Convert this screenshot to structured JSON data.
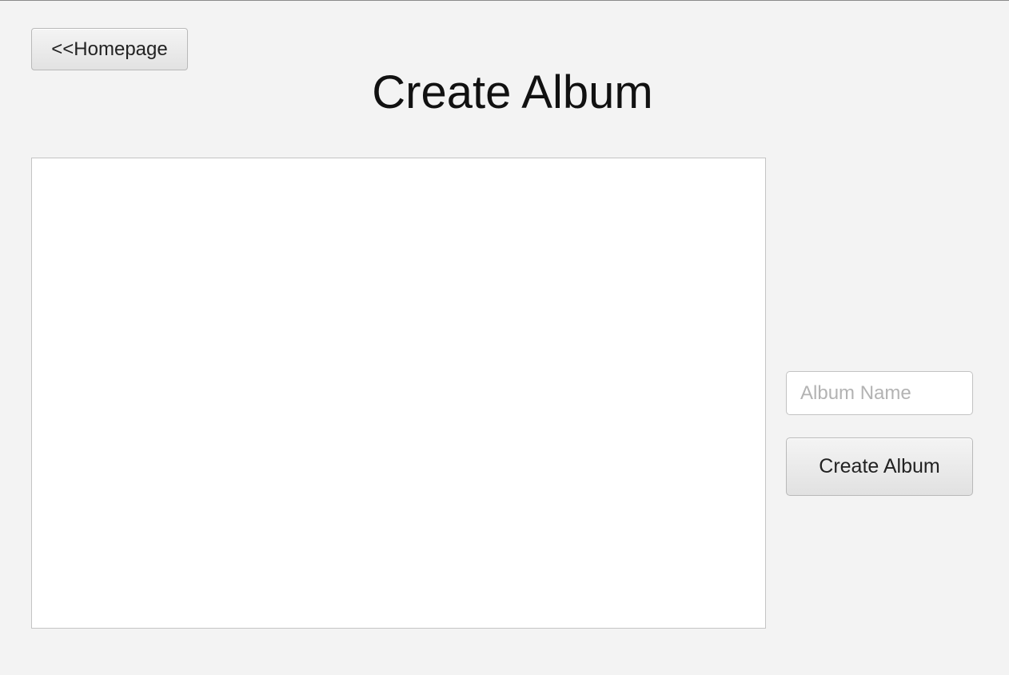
{
  "nav": {
    "back_label": "<<Homepage"
  },
  "header": {
    "title": "Create Album"
  },
  "album_list": {
    "items": []
  },
  "form": {
    "album_name_placeholder": "Album Name",
    "album_name_value": "",
    "create_label": "Create Album"
  }
}
